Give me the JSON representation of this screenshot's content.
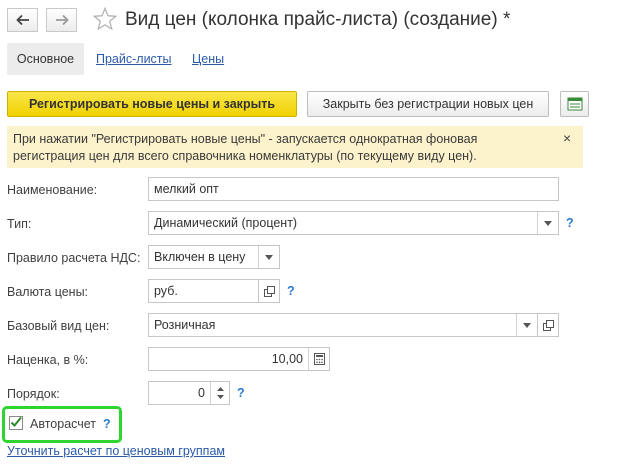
{
  "window": {
    "title": "Вид цен (колонка прайс-листа) (создание) *"
  },
  "tabs": [
    {
      "label": "Основное"
    },
    {
      "label": "Прайс-листы"
    },
    {
      "label": "Цены"
    }
  ],
  "toolbar": {
    "register_close_label": "Регистрировать новые цены и закрыть",
    "close_no_register_label": "Закрыть без регистрации новых цен"
  },
  "banner": {
    "text": "При нажатии \"Регистрировать новые цены\" - запускается однократная фоновая регистрация цен для всего справочника номенклатуры (по текущему виду цен).",
    "close_glyph": "×"
  },
  "form": {
    "name": {
      "label": "Наименование:",
      "value": "мелкий опт"
    },
    "type": {
      "label": "Тип:",
      "value": "Динамический (процент)"
    },
    "vat_rule": {
      "label": "Правило расчета НДС:",
      "value": "Включен в цену"
    },
    "currency": {
      "label": "Валюта цены:",
      "value": "руб."
    },
    "base_price_type": {
      "label": "Базовый вид цен:",
      "value": "Розничная"
    },
    "markup": {
      "label": "Наценка, в %:",
      "value": "10,00"
    },
    "order": {
      "label": "Порядок:",
      "value": "0"
    },
    "autocalc": {
      "label": "Авторасчет",
      "checked": true
    },
    "help_glyph": "?",
    "refine_link": "Уточнить расчет по ценовым группам"
  },
  "colors": {
    "accent_yellow": "#f2d600",
    "link_blue": "#2a5aa8",
    "highlight_green": "#2fd52f"
  }
}
